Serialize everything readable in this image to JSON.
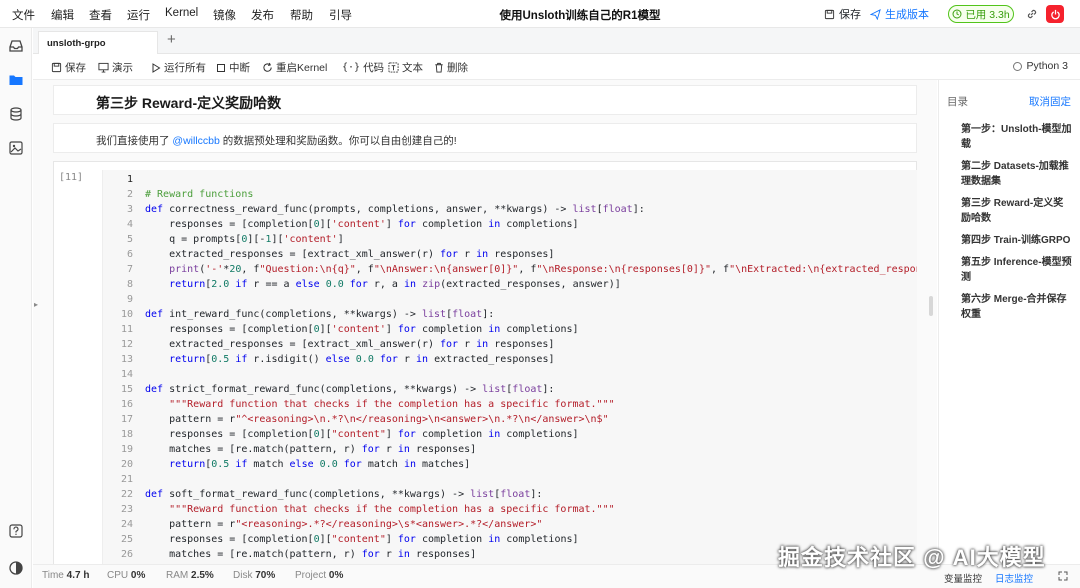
{
  "menubar": {
    "items": [
      "文件",
      "编辑",
      "查看",
      "运行",
      "Kernel",
      "镜像",
      "发布",
      "帮助",
      "引导"
    ],
    "title": "使用Unsloth训练自己的R1模型",
    "save_label": "保存",
    "publish_label": "生成版本",
    "usage_label": "已用 3.3h",
    "accent_color": "#1677ff",
    "danger_color": "#f5222d"
  },
  "leftbar": {
    "icons": [
      "inbox-icon",
      "folder-icon",
      "database-icon",
      "image-icon",
      "help-icon",
      "theme-icon"
    ]
  },
  "tabs": {
    "active_label": "unsloth-grpo",
    "add_label": "+"
  },
  "toolbar": {
    "save": "保存",
    "present": "演示",
    "run_all": "运行所有",
    "interrupt": "中断",
    "restart": "重启Kernel",
    "code": "代码",
    "text": "文本",
    "delete": "删除",
    "kernel": "Python 3"
  },
  "notebook": {
    "heading": "第三步 Reward-定义奖励哈数",
    "paragraph_pre": "我们直接使用了 ",
    "paragraph_mention": "@willccbb",
    "paragraph_post": " 的数据预处理和奖励函数。你可以自由创建自己的!",
    "prompt": "[11]",
    "code_lines": [
      [
        [
          "",
          ""
        ]
      ],
      [
        [
          "c",
          "# Reward functions"
        ]
      ],
      [
        [
          "k",
          "def"
        ],
        [
          "",
          "correctness_reward_func(prompts, completions, answer, **kwargs) -> "
        ],
        [
          "b",
          "list"
        ],
        [
          "",
          "["
        ],
        [
          "b",
          "float"
        ],
        [
          "",
          "]:"
        ]
      ],
      [
        [
          "",
          "    responses = [completion["
        ],
        [
          "n",
          "0"
        ],
        [
          "",
          "]["
        ],
        [
          "s",
          "'content'"
        ],
        [
          "",
          "] "
        ],
        [
          "k",
          "for"
        ],
        [
          "",
          "completion "
        ],
        [
          "k",
          "in"
        ],
        [
          "",
          "completions]"
        ]
      ],
      [
        [
          "",
          "    q = prompts["
        ],
        [
          "n",
          "0"
        ],
        [
          "",
          "][-"
        ],
        [
          "n",
          "1"
        ],
        [
          "",
          "]["
        ],
        [
          "s",
          "'content'"
        ],
        [
          "",
          "]"
        ]
      ],
      [
        [
          "",
          "    extracted_responses = [extract_xml_answer(r) "
        ],
        [
          "k",
          "for"
        ],
        [
          "",
          "r "
        ],
        [
          "k",
          "in"
        ],
        [
          "",
          "responses]"
        ]
      ],
      [
        [
          "",
          "    "
        ],
        [
          "b",
          "print"
        ],
        [
          "",
          "("
        ],
        [
          "s",
          "'-'"
        ],
        [
          "",
          "*"
        ],
        [
          "n",
          "20"
        ],
        [
          "",
          ", f"
        ],
        [
          "s",
          "\"Question:\\n{q}\""
        ],
        [
          "",
          ", f"
        ],
        [
          "s",
          "\"\\nAnswer:\\n{answer[0]}\""
        ],
        [
          "",
          ", f"
        ],
        [
          "s",
          "\"\\nResponse:\\n{responses[0]}\""
        ],
        [
          "",
          ", f"
        ],
        [
          "s",
          "\"\\nExtracted:\\n{extracted_responses"
        ]
      ],
      [
        [
          "",
          "    "
        ],
        [
          "k",
          "return"
        ],
        [
          "",
          "["
        ],
        [
          "n",
          "2.0"
        ],
        [
          "",
          ""
        ],
        [
          "k",
          "if"
        ],
        [
          "",
          "r == a "
        ],
        [
          "k",
          "else"
        ],
        [
          "",
          ""
        ],
        [
          "n",
          "0.0"
        ],
        [
          "",
          ""
        ],
        [
          "k",
          "for"
        ],
        [
          "",
          "r, a "
        ],
        [
          "k",
          "in"
        ],
        [
          "",
          ""
        ],
        [
          "b",
          "zip"
        ],
        [
          "",
          "(extracted_responses, answer)]"
        ]
      ],
      [
        [
          "",
          ""
        ]
      ],
      [
        [
          "k",
          "def"
        ],
        [
          "",
          "int_reward_func(completions, **kwargs) -> "
        ],
        [
          "b",
          "list"
        ],
        [
          "",
          "["
        ],
        [
          "b",
          "float"
        ],
        [
          "",
          "]:"
        ]
      ],
      [
        [
          "",
          "    responses = [completion["
        ],
        [
          "n",
          "0"
        ],
        [
          "",
          "]["
        ],
        [
          "s",
          "'content'"
        ],
        [
          "",
          "] "
        ],
        [
          "k",
          "for"
        ],
        [
          "",
          "completion "
        ],
        [
          "k",
          "in"
        ],
        [
          "",
          "completions]"
        ]
      ],
      [
        [
          "",
          "    extracted_responses = [extract_xml_answer(r) "
        ],
        [
          "k",
          "for"
        ],
        [
          "",
          "r "
        ],
        [
          "k",
          "in"
        ],
        [
          "",
          "responses]"
        ]
      ],
      [
        [
          "",
          "    "
        ],
        [
          "k",
          "return"
        ],
        [
          "",
          "["
        ],
        [
          "n",
          "0.5"
        ],
        [
          "",
          ""
        ],
        [
          "k",
          "if"
        ],
        [
          "",
          "r.isdigit() "
        ],
        [
          "k",
          "else"
        ],
        [
          "",
          ""
        ],
        [
          "n",
          "0.0"
        ],
        [
          "",
          ""
        ],
        [
          "k",
          "for"
        ],
        [
          "",
          "r "
        ],
        [
          "k",
          "in"
        ],
        [
          "",
          "extracted_responses]"
        ]
      ],
      [
        [
          "",
          ""
        ]
      ],
      [
        [
          "k",
          "def"
        ],
        [
          "",
          "strict_format_reward_func(completions, **kwargs) -> "
        ],
        [
          "b",
          "list"
        ],
        [
          "",
          "["
        ],
        [
          "b",
          "float"
        ],
        [
          "",
          "]:"
        ]
      ],
      [
        [
          "",
          "    "
        ],
        [
          "s",
          "\"\"\"Reward function that checks if the completion has a specific format.\"\"\""
        ]
      ],
      [
        [
          "",
          "    pattern = r"
        ],
        [
          "s",
          "\"^<reasoning>\\n.*?\\n</reasoning>\\n<answer>\\n.*?\\n</answer>\\n$\""
        ]
      ],
      [
        [
          "",
          "    responses = [completion["
        ],
        [
          "n",
          "0"
        ],
        [
          "",
          "]["
        ],
        [
          "s",
          "\"content\""
        ],
        [
          "",
          "] "
        ],
        [
          "k",
          "for"
        ],
        [
          "",
          "completion "
        ],
        [
          "k",
          "in"
        ],
        [
          "",
          "completions]"
        ]
      ],
      [
        [
          "",
          "    matches = [re.match(pattern, r) "
        ],
        [
          "k",
          "for"
        ],
        [
          "",
          "r "
        ],
        [
          "k",
          "in"
        ],
        [
          "",
          "responses]"
        ]
      ],
      [
        [
          "",
          "    "
        ],
        [
          "k",
          "return"
        ],
        [
          "",
          "["
        ],
        [
          "n",
          "0.5"
        ],
        [
          "",
          ""
        ],
        [
          "k",
          "if"
        ],
        [
          "",
          "match "
        ],
        [
          "k",
          "else"
        ],
        [
          "",
          ""
        ],
        [
          "n",
          "0.0"
        ],
        [
          "",
          ""
        ],
        [
          "k",
          "for"
        ],
        [
          "",
          "match "
        ],
        [
          "k",
          "in"
        ],
        [
          "",
          "matches]"
        ]
      ],
      [
        [
          "",
          ""
        ]
      ],
      [
        [
          "k",
          "def"
        ],
        [
          "",
          "soft_format_reward_func(completions, **kwargs) -> "
        ],
        [
          "b",
          "list"
        ],
        [
          "",
          "["
        ],
        [
          "b",
          "float"
        ],
        [
          "",
          "]:"
        ]
      ],
      [
        [
          "",
          "    "
        ],
        [
          "s",
          "\"\"\"Reward function that checks if the completion has a specific format.\"\"\""
        ]
      ],
      [
        [
          "",
          "    pattern = r"
        ],
        [
          "s",
          "\"<reasoning>.*?</reasoning>\\s*<answer>.*?</answer>\""
        ]
      ],
      [
        [
          "",
          "    responses = [completion["
        ],
        [
          "n",
          "0"
        ],
        [
          "",
          "]["
        ],
        [
          "s",
          "\"content\""
        ],
        [
          "",
          "] "
        ],
        [
          "k",
          "for"
        ],
        [
          "",
          "completion "
        ],
        [
          "k",
          "in"
        ],
        [
          "",
          "completions]"
        ]
      ],
      [
        [
          "",
          "    matches = [re.match(pattern, r) "
        ],
        [
          "k",
          "for"
        ],
        [
          "",
          "r "
        ],
        [
          "k",
          "in"
        ],
        [
          "",
          "responses]"
        ]
      ]
    ]
  },
  "outline": {
    "title": "目录",
    "unpin": "取消固定",
    "items": [
      "第一步：Unsloth-模型加载",
      "第二步 Datasets-加载推理数据集",
      "第三步 Reward-定义奖励哈数",
      "第四步 Train-训练GRPO",
      "第五步 Inference-模型预测",
      "第六步 Merge-合并保存权重"
    ]
  },
  "status": {
    "time_label": "Time",
    "time_value": "4.7 h",
    "cpu_label": "CPU",
    "cpu_value": "0%",
    "ram_label": "RAM",
    "ram_value": "2.5%",
    "disk_label": "Disk",
    "disk_value": "70%",
    "project_label": "Project",
    "project_value": "0%",
    "var_monitor": "变量监控",
    "log_monitor": "日志监控"
  },
  "watermark": "掘金技术社区 @ AI大模型"
}
